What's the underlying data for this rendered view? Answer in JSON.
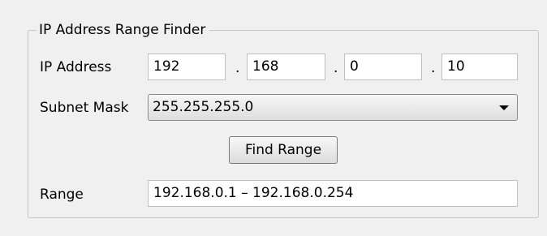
{
  "group": {
    "title": "IP Address Range Finder"
  },
  "ip": {
    "label": "IP Address",
    "octet1": "192",
    "octet2": "168",
    "octet3": "0",
    "octet4": "10",
    "separator": "."
  },
  "subnet": {
    "label": "Subnet Mask",
    "selected": "255.255.255.0",
    "icon": "chevron-down-icon"
  },
  "actions": {
    "find_label": "Find Range"
  },
  "range": {
    "label": "Range",
    "value": "192.168.0.1 – 192.168.0.254"
  }
}
